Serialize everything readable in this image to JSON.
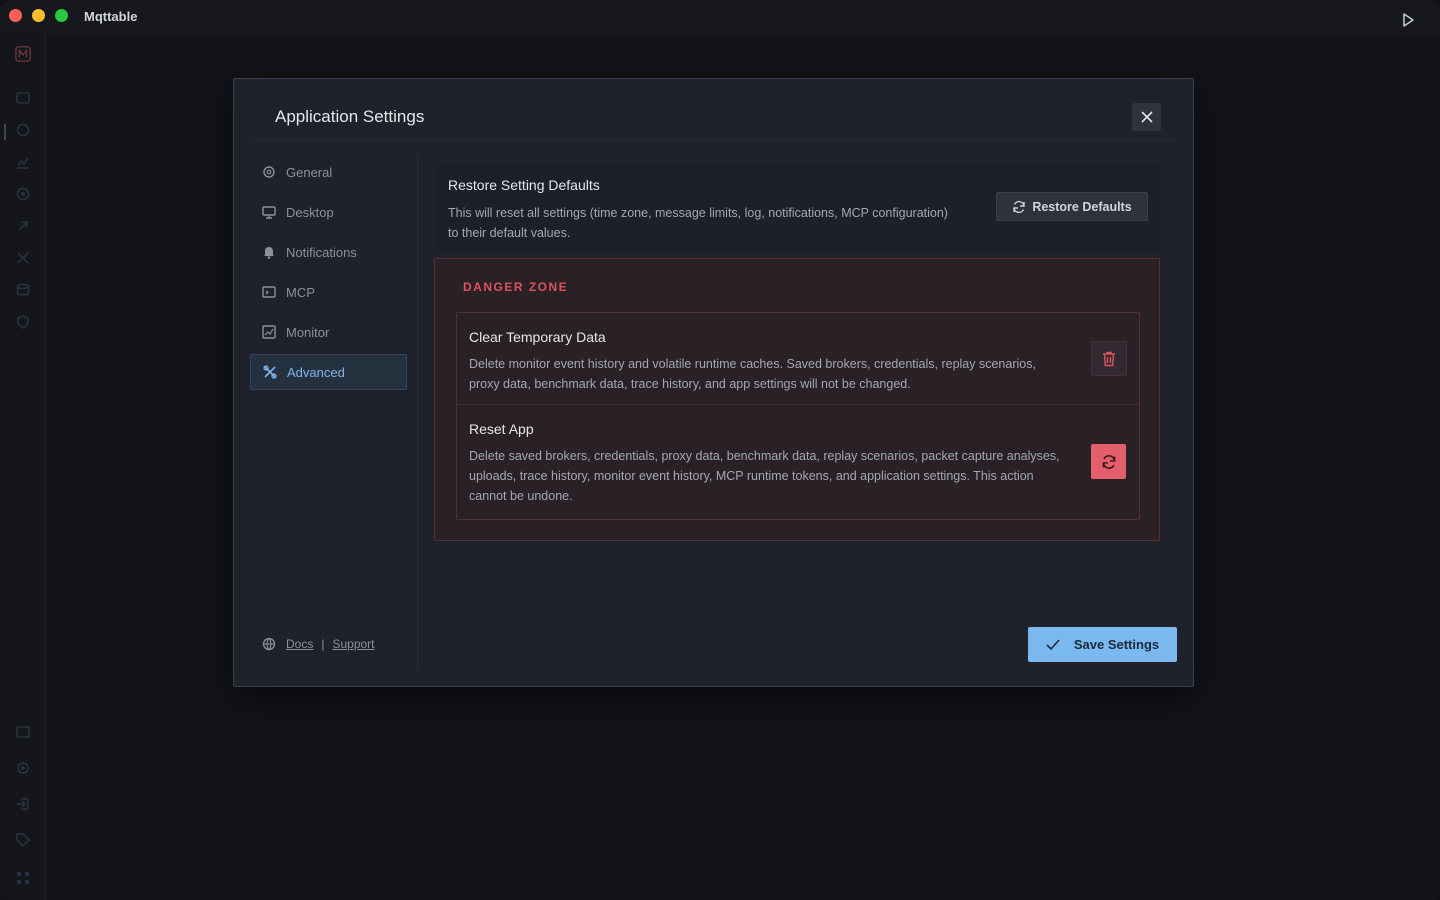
{
  "app": {
    "title": "Mqttable"
  },
  "modal": {
    "title": "Application Settings"
  },
  "nav": {
    "items": [
      {
        "label": "General",
        "icon": "gear-icon"
      },
      {
        "label": "Desktop",
        "icon": "monitor-icon"
      },
      {
        "label": "Notifications",
        "icon": "bell-icon"
      },
      {
        "label": "MCP",
        "icon": "terminal-icon"
      },
      {
        "label": "Monitor",
        "icon": "chart-icon"
      },
      {
        "label": "Advanced",
        "icon": "tools-icon"
      }
    ],
    "active": "Advanced"
  },
  "footer": {
    "docs": "Docs",
    "separator": "|",
    "support": "Support"
  },
  "restore": {
    "title": "Restore Setting Defaults",
    "description": "This will reset all settings (time zone, message limits, log, notifications, MCP configuration) to their default values.",
    "button": "Restore Defaults"
  },
  "danger": {
    "label": "DANGER ZONE",
    "clear": {
      "title": "Clear Temporary Data",
      "description": "Delete monitor event history and volatile runtime caches. Saved brokers, credentials, replay scenarios, proxy data, benchmark data, trace history, and app settings will not be changed."
    },
    "reset": {
      "title": "Reset App",
      "description": "Delete saved brokers, credentials, proxy data, benchmark data, replay scenarios, packet capture analyses, uploads, trace history, monitor event history, MCP runtime tokens, and application settings. This action cannot be undone."
    }
  },
  "save": {
    "label": "Save Settings"
  },
  "colors": {
    "accent": "#7ab8f0",
    "danger": "#e35f6c",
    "danger_text": "#d9545e"
  }
}
